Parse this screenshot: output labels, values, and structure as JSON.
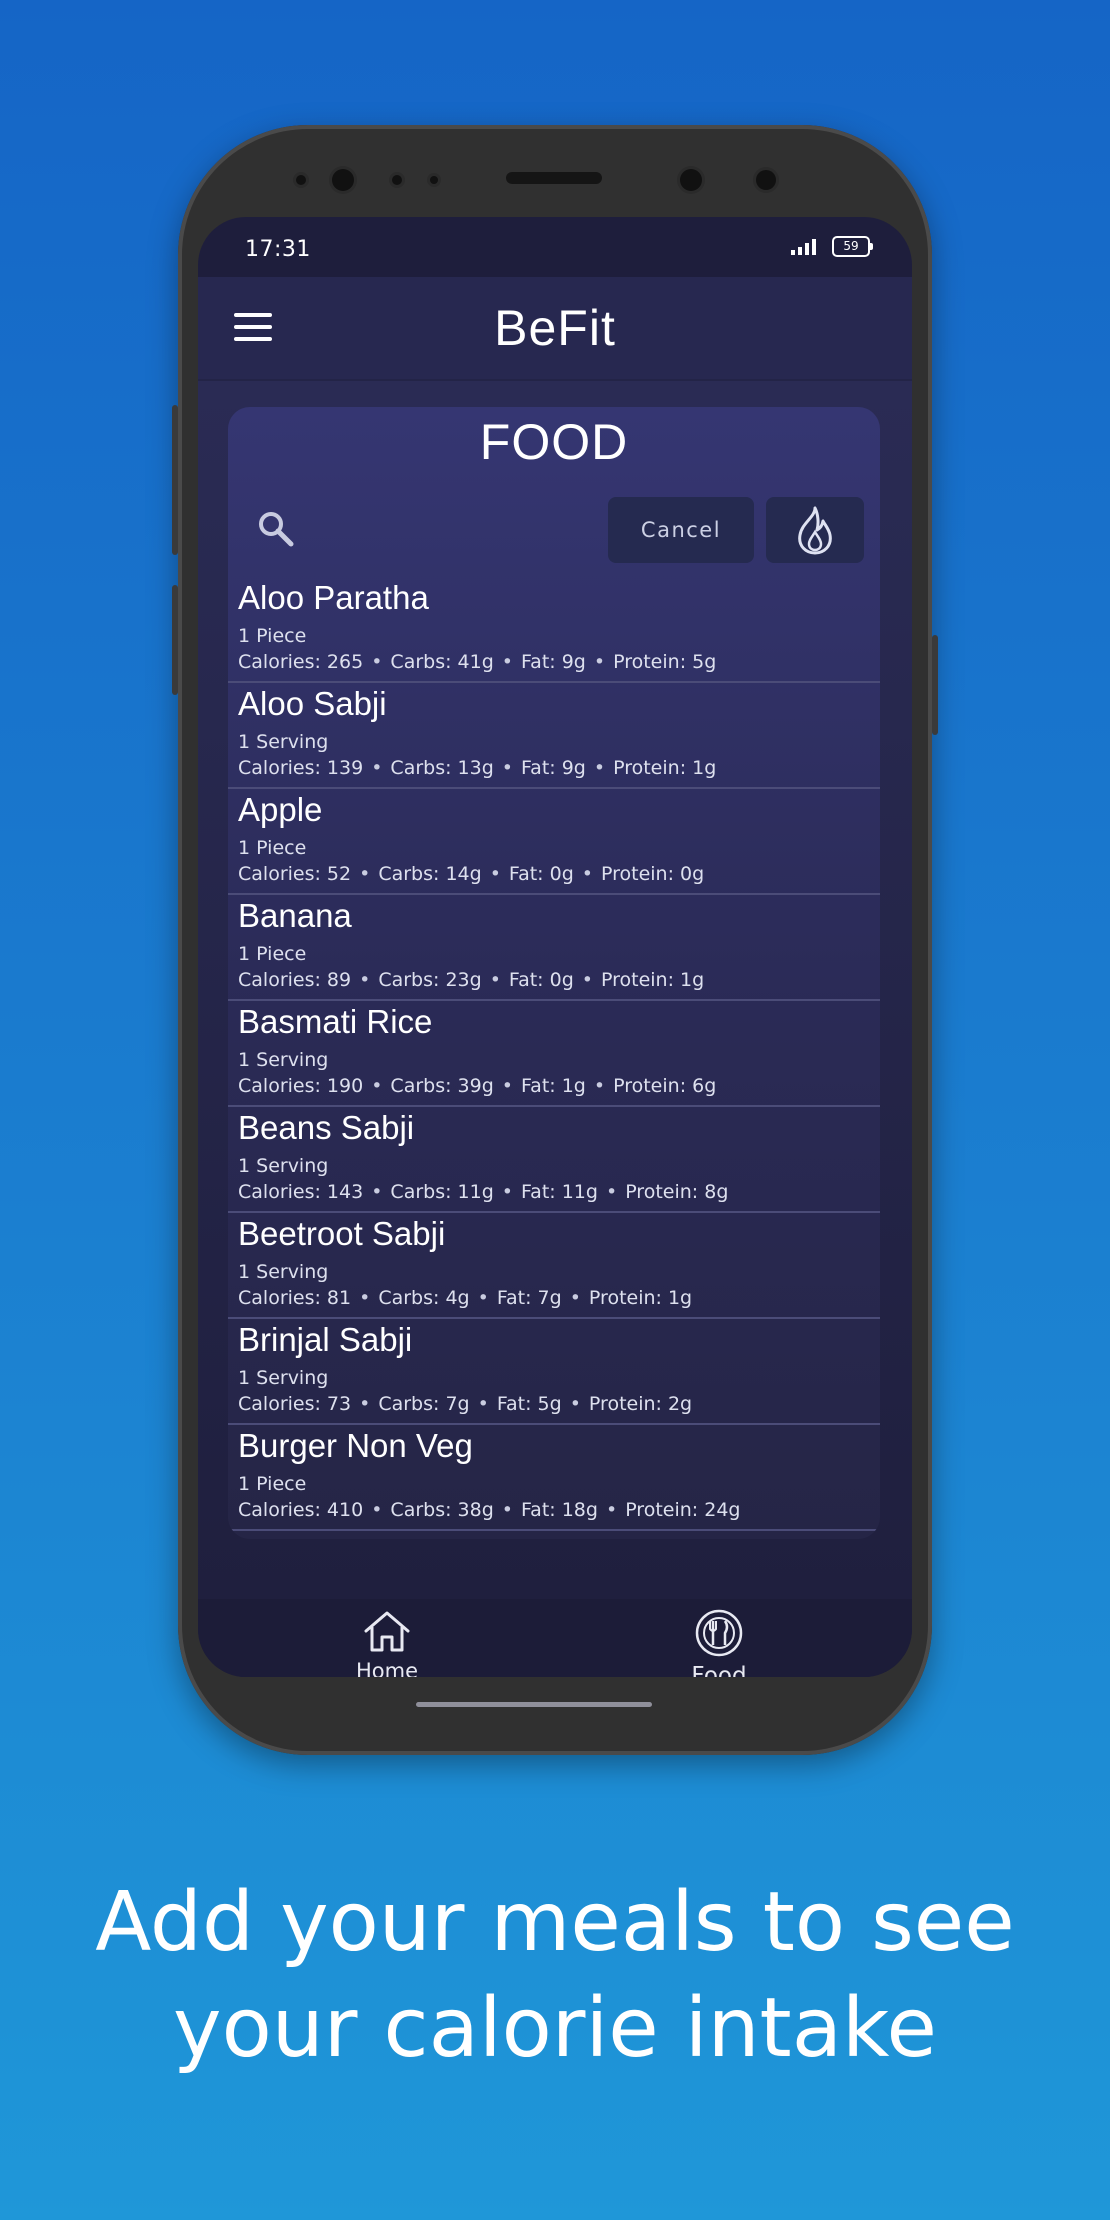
{
  "status_bar": {
    "time": "17:31",
    "battery": "59"
  },
  "app_bar": {
    "title": "BeFit",
    "menu_icon": "hamburger-menu-icon"
  },
  "food_card": {
    "title": "FOOD",
    "search_icon": "search-icon",
    "cancel_label": "Cancel",
    "calories_icon": "flame-icon",
    "items": [
      {
        "name": "Aloo Paratha",
        "serving": "1 Piece",
        "calories": "Calories: 265",
        "carbs": "Carbs: 41g",
        "fat": "Fat: 9g",
        "protein": "Protein: 5g"
      },
      {
        "name": "Aloo Sabji",
        "serving": "1 Serving",
        "calories": "Calories: 139",
        "carbs": "Carbs: 13g",
        "fat": "Fat: 9g",
        "protein": "Protein: 1g"
      },
      {
        "name": "Apple",
        "serving": "1 Piece",
        "calories": "Calories: 52",
        "carbs": "Carbs: 14g",
        "fat": "Fat: 0g",
        "protein": "Protein: 0g"
      },
      {
        "name": "Banana",
        "serving": "1 Piece",
        "calories": "Calories: 89",
        "carbs": "Carbs: 23g",
        "fat": "Fat: 0g",
        "protein": "Protein: 1g"
      },
      {
        "name": "Basmati Rice",
        "serving": "1 Serving",
        "calories": "Calories: 190",
        "carbs": "Carbs: 39g",
        "fat": "Fat: 1g",
        "protein": "Protein: 6g"
      },
      {
        "name": "Beans Sabji",
        "serving": "1 Serving",
        "calories": "Calories: 143",
        "carbs": "Carbs: 11g",
        "fat": "Fat: 11g",
        "protein": "Protein: 8g"
      },
      {
        "name": "Beetroot Sabji",
        "serving": "1 Serving",
        "calories": "Calories: 81",
        "carbs": "Carbs: 4g",
        "fat": "Fat: 7g",
        "protein": "Protein: 1g"
      },
      {
        "name": "Brinjal Sabji",
        "serving": "1 Serving",
        "calories": "Calories: 73",
        "carbs": "Carbs: 7g",
        "fat": "Fat: 5g",
        "protein": "Protein: 2g"
      },
      {
        "name": "Burger Non Veg",
        "serving": "1 Piece",
        "calories": "Calories: 410",
        "carbs": "Carbs: 38g",
        "fat": "Fat: 18g",
        "protein": "Protein: 24g"
      }
    ]
  },
  "bottom_nav": {
    "home_label": "Home",
    "home_icon": "home-icon",
    "food_label": "Food",
    "food_icon": "plate-cutlery-icon"
  },
  "promo": {
    "line1": "Add your meals to see",
    "line2": "your calorie intake"
  },
  "colors": {
    "background_top": "#1565c6",
    "background_bottom": "#1f97d8",
    "screen_bg": "#1e1e3c",
    "card_bg": "#353672"
  }
}
